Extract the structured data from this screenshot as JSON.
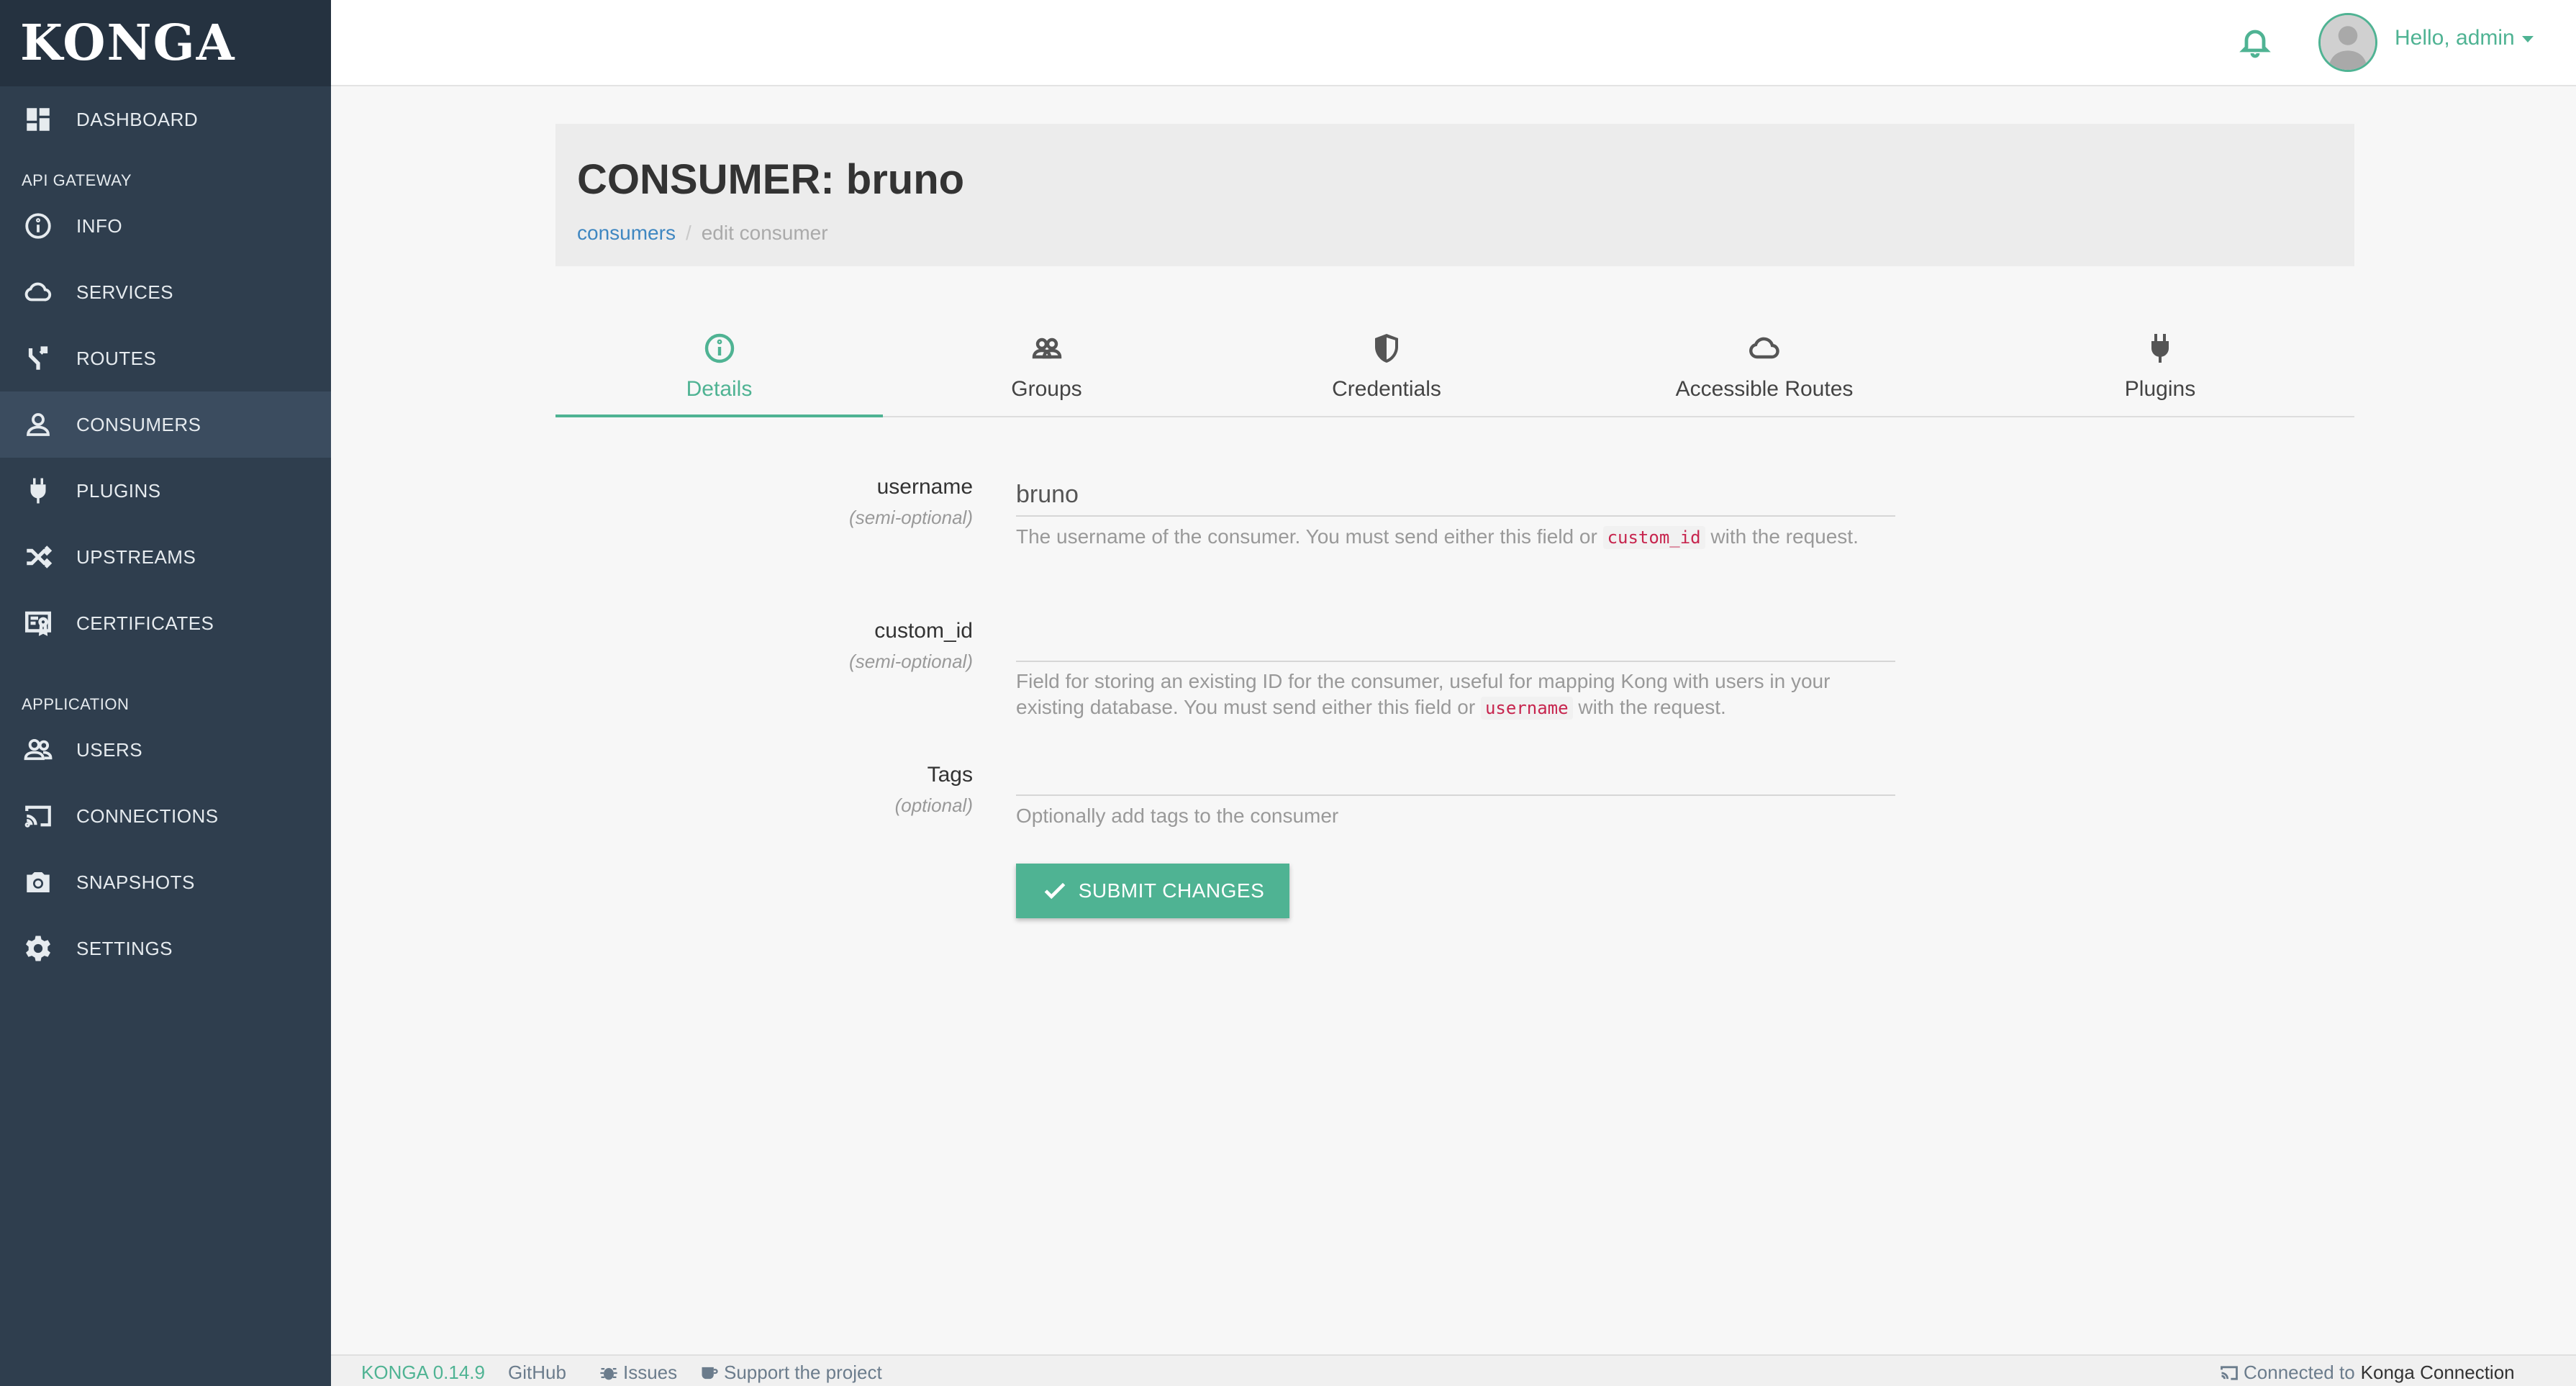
{
  "brand": "KONGA",
  "sidebar": {
    "items": [
      {
        "label": "DASHBOARD"
      },
      {
        "label": "INFO"
      },
      {
        "label": "SERVICES"
      },
      {
        "label": "ROUTES"
      },
      {
        "label": "CONSUMERS"
      },
      {
        "label": "PLUGINS"
      },
      {
        "label": "UPSTREAMS"
      },
      {
        "label": "CERTIFICATES"
      },
      {
        "label": "USERS"
      },
      {
        "label": "CONNECTIONS"
      },
      {
        "label": "SNAPSHOTS"
      },
      {
        "label": "SETTINGS"
      }
    ],
    "sections": [
      "API GATEWAY",
      "APPLICATION"
    ],
    "active": "CONSUMERS"
  },
  "topbar": {
    "greeting": "Hello, admin"
  },
  "header": {
    "title": "CONSUMER: bruno",
    "breadcrumb": {
      "link": "consumers",
      "separator": "/",
      "current": "edit consumer"
    }
  },
  "tabs": [
    {
      "label": "Details",
      "icon": "info-icon",
      "active": true
    },
    {
      "label": "Groups",
      "icon": "groups-icon"
    },
    {
      "label": "Credentials",
      "icon": "shield-icon"
    },
    {
      "label": "Accessible Routes",
      "icon": "cloud-icon"
    },
    {
      "label": "Plugins",
      "icon": "plug-icon"
    }
  ],
  "form": {
    "username": {
      "label": "username",
      "sub": "(semi-optional)",
      "value": "bruno",
      "help_pre": "The username of the consumer. You must send either this field or",
      "help_code": "custom_id",
      "help_post": "with the request."
    },
    "custom_id": {
      "label": "custom_id",
      "sub": "(semi-optional)",
      "value": "",
      "help_pre": "Field for storing an existing ID for the consumer, useful for mapping Kong with users in your existing database. You must send either this field or",
      "help_code": "username",
      "help_post": "with the request."
    },
    "tags": {
      "label": "Tags",
      "sub": "(optional)",
      "value": "",
      "help": "Optionally add tags to the consumer"
    },
    "submit_label": "SUBMIT CHANGES"
  },
  "footer": {
    "version": "KONGA 0.14.9",
    "github": "GitHub",
    "issues": "Issues",
    "support": "Support the project",
    "connected_prefix": "Connected to",
    "connection_name": "Konga Connection"
  },
  "colors": {
    "sidebar_bg": "#2f3e4e",
    "brand_bg": "#253240",
    "accent": "#4fb393",
    "link": "#3f87c1",
    "code": "#c7254e"
  }
}
